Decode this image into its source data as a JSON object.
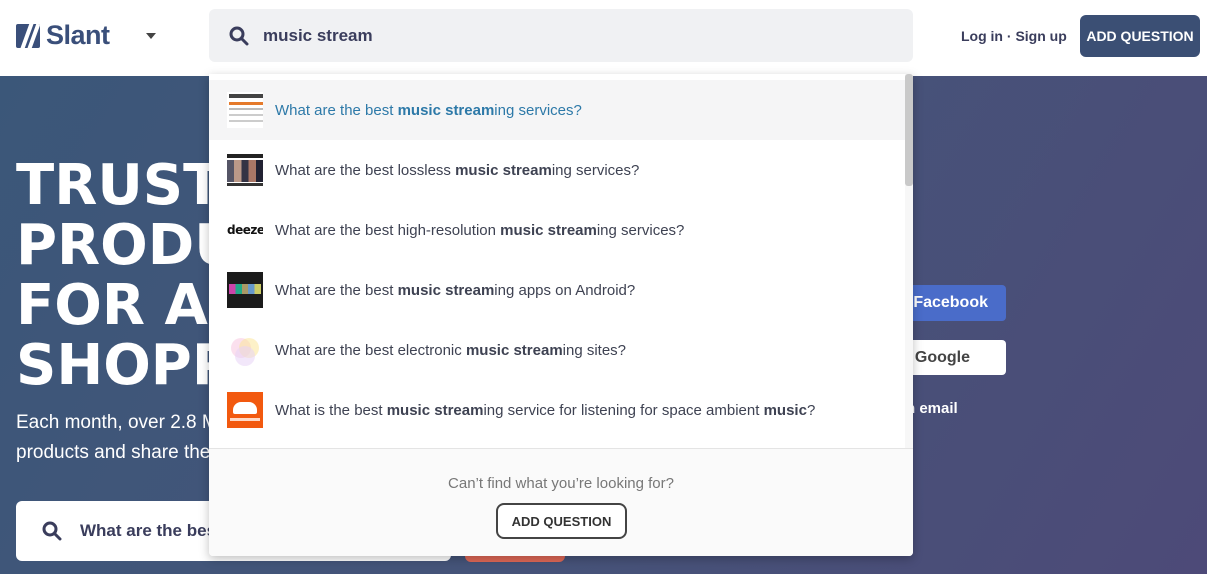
{
  "header": {
    "logo_text": "Slant",
    "search_value": "music stream",
    "login_label": "Log in",
    "separator": "·",
    "signup_label": "Sign up",
    "add_question_label": "ADD QUESTION"
  },
  "hero": {
    "title_lines": [
      "TRUSTW",
      "PRODUC",
      "FOR ALI",
      "SHOPPI"
    ],
    "subtitle_lines": [
      "Each month, over 2.8 M",
      "products and share the"
    ],
    "search_placeholder": "What are the best",
    "facebook_label": "n Facebook",
    "google_label": "n Google",
    "email_label": "n email"
  },
  "dropdown": {
    "results": [
      {
        "prefix": "What are the best ",
        "bold": "music stream",
        "suffix": "ing services?",
        "thumb": "best-music-streaming-thumbnail"
      },
      {
        "prefix": "What are the best lossless ",
        "bold": "music stream",
        "suffix": "ing services?",
        "thumb": "lossless-thumbnail"
      },
      {
        "prefix": "What are the best high-resolution ",
        "bold": "music stream",
        "suffix": "ing services?",
        "thumb": "deezer-logo",
        "thumb_text": "deezer"
      },
      {
        "prefix": "What are the best ",
        "bold": "music stream",
        "suffix": "ing apps on Android?",
        "thumb": "android-apps-thumbnail"
      },
      {
        "prefix": "What are the best electronic ",
        "bold": "music stream",
        "suffix": "ing sites?",
        "thumb": "electronic-sites-thumbnail"
      },
      {
        "prefix": "What is the best ",
        "bold": "music stream",
        "suffix": "ing service for listening for space ambient ",
        "bold2": "music",
        "suffix2": "?",
        "thumb": "soundcloud-logo"
      }
    ],
    "footer_text": "Can’t find what you’re looking for?",
    "add_question_label": "ADD QUESTION"
  },
  "colors": {
    "brand": "#3a4f7a",
    "link_active": "#2d79a8",
    "facebook": "#4a6cc9"
  }
}
